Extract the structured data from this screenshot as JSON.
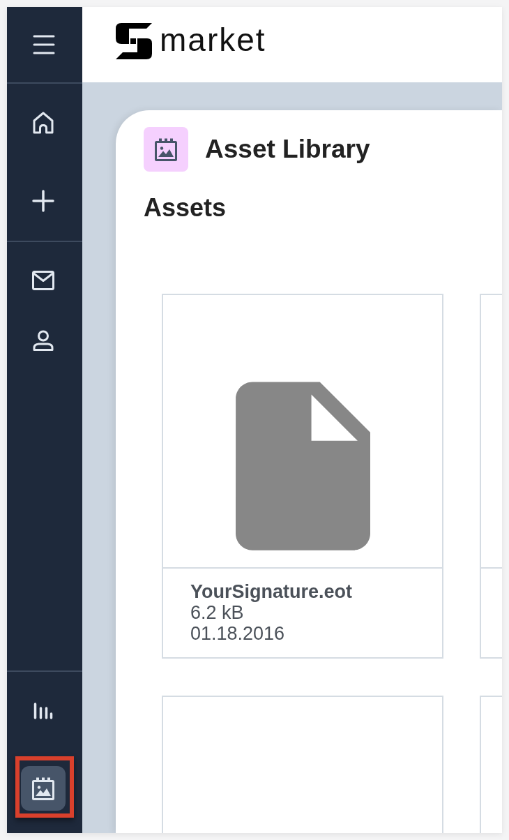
{
  "header": {
    "logo_text": "market"
  },
  "sidebar": {
    "top_groups": [
      {
        "items": [
          {
            "kind": "home",
            "selected": false,
            "highlighted": false
          },
          {
            "kind": "add",
            "selected": false,
            "highlighted": false
          }
        ]
      },
      {
        "items": [
          {
            "kind": "mail",
            "selected": false,
            "highlighted": false
          },
          {
            "kind": "user",
            "selected": false,
            "highlighted": false
          }
        ]
      }
    ],
    "bottom_groups": [
      {
        "items": [
          {
            "kind": "chart",
            "selected": false,
            "highlighted": false
          },
          {
            "kind": "media",
            "selected": true,
            "highlighted": true
          }
        ]
      }
    ]
  },
  "page": {
    "title": "Asset Library",
    "section_title": "Assets",
    "assets": [
      {
        "kind": "file",
        "name": "YourSignature.eot",
        "size": "6.2 kB",
        "date": "01.18.2016"
      },
      {
        "kind": "blank"
      },
      {
        "kind": "blank"
      },
      {
        "kind": "blank"
      }
    ]
  }
}
